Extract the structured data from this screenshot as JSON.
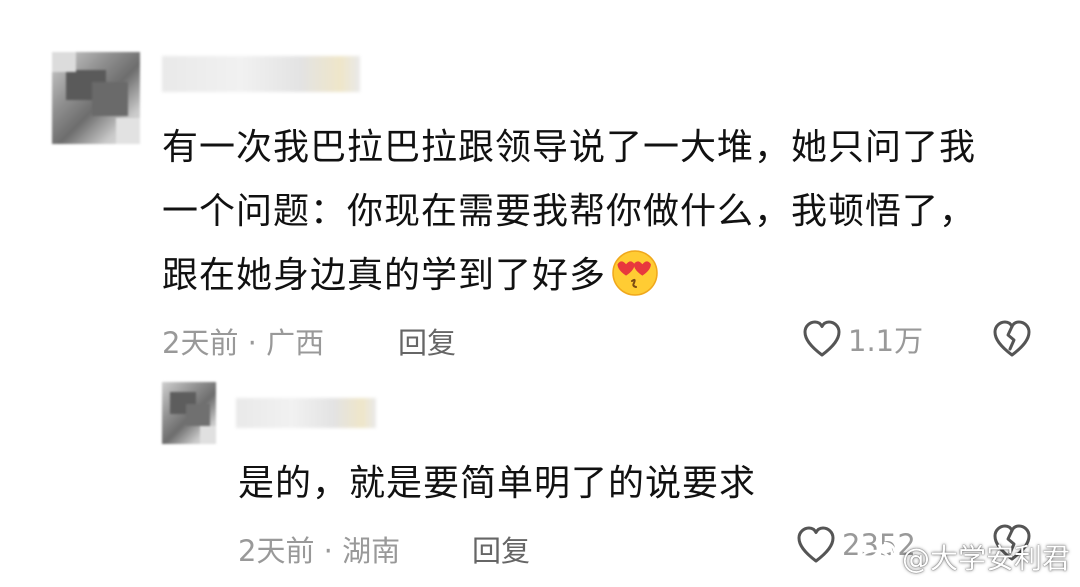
{
  "comment": {
    "text_line1": "有一次我巴拉巴拉跟领导说了一大堆，她只问了我",
    "text_line2": "一个问题：你现在需要我帮你做什么，我顿悟了，",
    "text_line3": "跟在她身边真的学到了好多",
    "emoji": "heart-eyes-kiss-emoji",
    "meta": "2天前 · 广西",
    "reply_label": "回复",
    "like_count": "1.1万"
  },
  "reply": {
    "text": "是的，就是要简单明了的说要求",
    "meta": "2天前 · 湖南",
    "reply_label": "回复",
    "like_count": "2352"
  },
  "watermark": {
    "icon": "weibo-logo-icon",
    "text": "@大学安利君"
  },
  "colors": {
    "text": "#111111",
    "meta": "#999999",
    "reply": "#666666",
    "icon": "#555555",
    "emoji_face": "#ffcc33",
    "emoji_heart": "#e8383d"
  }
}
